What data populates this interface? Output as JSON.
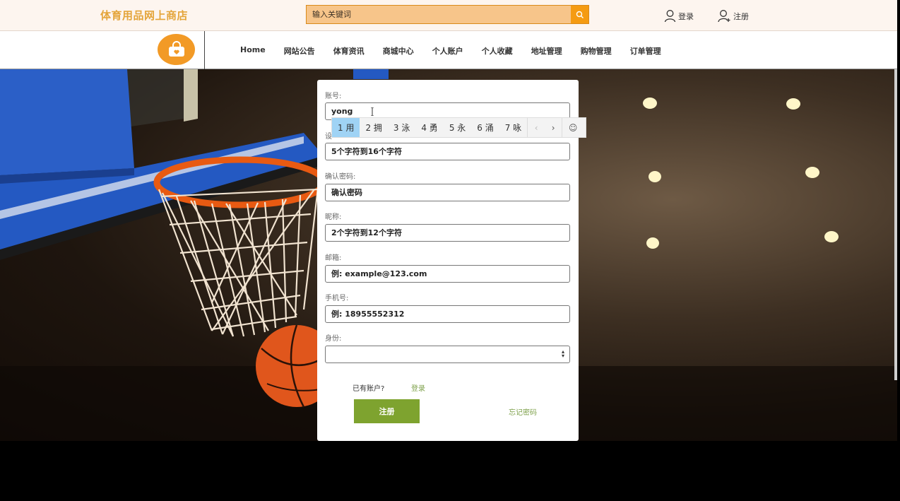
{
  "header": {
    "site_title": "体育用品网上商店",
    "search_placeholder": "输入关键词",
    "login_label": "登录",
    "register_label": "注册"
  },
  "nav": {
    "items": [
      "Home",
      "网站公告",
      "体育资讯",
      "商城中心",
      "个人账户",
      "个人收藏",
      "地址管理",
      "购物管理",
      "订单管理"
    ]
  },
  "form": {
    "account_label": "账号:",
    "account_value": "yong",
    "password_label": "设",
    "password_placeholder": "5个字符到16个字符",
    "confirm_label": "确认密码:",
    "confirm_placeholder": "确认密码",
    "nickname_label": "昵称:",
    "nickname_placeholder": "2个字符到12个字符",
    "email_label": "邮箱:",
    "email_placeholder": "例: example@123.com",
    "phone_label": "手机号:",
    "phone_placeholder": "例: 18955552312",
    "identity_label": "身份:",
    "identity_value": "",
    "has_account": "已有账户?",
    "login_link": "登录",
    "submit_label": "注册",
    "forgot_label": "忘记密码"
  },
  "ime": {
    "candidates": [
      "1 用",
      "2 拥",
      "3 泳",
      "4 勇",
      "5 永",
      "6 涌",
      "7 咏"
    ],
    "prev": "‹",
    "next": "›",
    "emoji": "☺"
  },
  "colors": {
    "accent_orange": "#f29a26",
    "title_gold": "#e4a53b",
    "submit_green": "#7ea32f",
    "link_green": "#7ea14b"
  }
}
